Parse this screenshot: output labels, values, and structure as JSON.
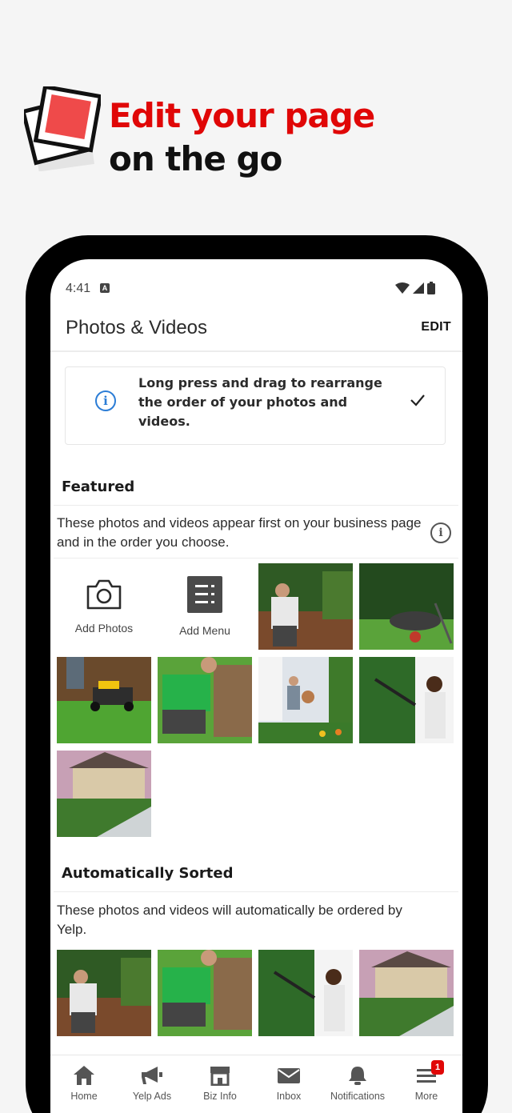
{
  "promo": {
    "headline_line1": "Edit your page",
    "headline_line2": "on the go",
    "icon": "photos-stack-icon",
    "accent_color": "#e00707"
  },
  "status_bar": {
    "time": "4:41",
    "notification_icon": "a-icon",
    "icons": [
      "wifi-icon",
      "signal-icon",
      "battery-icon"
    ]
  },
  "app_bar": {
    "title": "Photos & Videos",
    "action": "EDIT"
  },
  "tip": {
    "text": "Long press and drag to rearrange the order of your photos and videos.",
    "icon": "info-icon",
    "dismiss_icon": "check-icon",
    "icon_color": "#2c7dd6"
  },
  "featured": {
    "heading": "Featured",
    "description": "These photos and videos appear first on your business page and in the order you choose.",
    "actions": [
      {
        "label": "Add Photos",
        "icon": "camera-icon"
      },
      {
        "label": "Add Menu",
        "icon": "menu-icon"
      }
    ],
    "photos": [
      "photo-gardener-hedge",
      "photo-wheelbarrow-lawn",
      "photo-lawn-mower",
      "photo-laying-sod",
      "photo-tree-trimming",
      "photo-hedge-trimmer",
      "photo-house-garden"
    ]
  },
  "auto_sorted": {
    "heading": "Automatically Sorted",
    "description": "These photos and videos will automatically be ordered by Yelp.",
    "photos": [
      "photo-gardener-hedge",
      "photo-laying-sod",
      "photo-hedge-trimmer",
      "photo-house-garden"
    ]
  },
  "nav": {
    "items": [
      {
        "label": "Home",
        "icon": "home-icon"
      },
      {
        "label": "Yelp Ads",
        "icon": "megaphone-icon"
      },
      {
        "label": "Biz Info",
        "icon": "storefront-icon"
      },
      {
        "label": "Inbox",
        "icon": "mail-icon"
      },
      {
        "label": "Notifications",
        "icon": "bell-icon"
      },
      {
        "label": "More",
        "icon": "more-icon"
      }
    ],
    "more_badge": "1"
  }
}
